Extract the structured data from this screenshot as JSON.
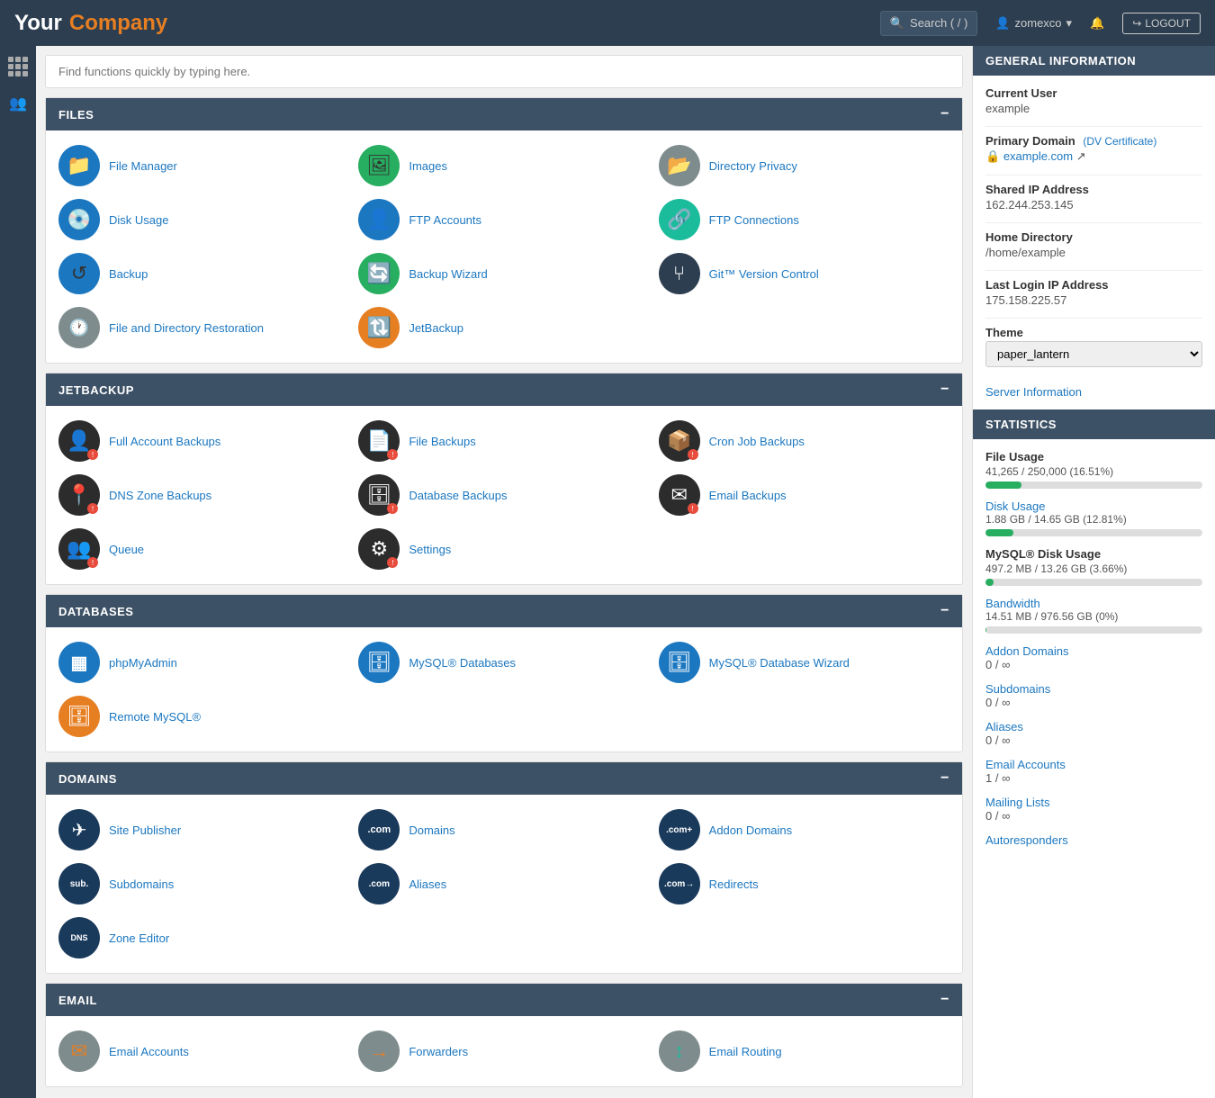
{
  "topNav": {
    "logoYour": "Your",
    "logoCompany": "Company",
    "searchPlaceholder": "Search ( / )",
    "username": "zomexco",
    "logoutLabel": "LOGOUT"
  },
  "mainSearch": {
    "placeholder": "Find functions quickly by typing here."
  },
  "sections": {
    "files": {
      "title": "FILES",
      "items": [
        {
          "label": "File Manager",
          "iconBg": "bg-blue",
          "iconText": "📁"
        },
        {
          "label": "Images",
          "iconBg": "bg-green",
          "iconText": "🖼"
        },
        {
          "label": "Directory Privacy",
          "iconBg": "bg-gray",
          "iconText": "📂"
        },
        {
          "label": "Disk Usage",
          "iconBg": "bg-blue",
          "iconText": "💿"
        },
        {
          "label": "FTP Accounts",
          "iconBg": "bg-blue",
          "iconText": "👤"
        },
        {
          "label": "FTP Connections",
          "iconBg": "bg-teal",
          "iconText": "🔗"
        },
        {
          "label": "Backup",
          "iconBg": "bg-blue",
          "iconText": "↺"
        },
        {
          "label": "Backup Wizard",
          "iconBg": "bg-green",
          "iconText": "🔄"
        },
        {
          "label": "Git™ Version Control",
          "iconBg": "bg-dark",
          "iconText": "⑂"
        },
        {
          "label": "File and Directory Restoration",
          "iconBg": "bg-gray",
          "iconText": "🕐"
        },
        {
          "label": "JetBackup",
          "iconBg": "bg-orange",
          "iconText": "🔃"
        }
      ]
    },
    "jetbackup": {
      "title": "JETBACKUP",
      "items": [
        {
          "label": "Full Account Backups",
          "iconBg": "bg-dark",
          "iconText": "👤"
        },
        {
          "label": "File Backups",
          "iconBg": "bg-dark",
          "iconText": "📄"
        },
        {
          "label": "Cron Job Backups",
          "iconBg": "bg-dark",
          "iconText": "📦"
        },
        {
          "label": "DNS Zone Backups",
          "iconBg": "bg-dark",
          "iconText": "📍"
        },
        {
          "label": "Database Backups",
          "iconBg": "bg-dark",
          "iconText": "🗄"
        },
        {
          "label": "Email Backups",
          "iconBg": "bg-dark",
          "iconText": "✉"
        },
        {
          "label": "Queue",
          "iconBg": "bg-dark",
          "iconText": "👥"
        },
        {
          "label": "Settings",
          "iconBg": "bg-dark",
          "iconText": "⚙"
        }
      ]
    },
    "databases": {
      "title": "DATABASES",
      "items": [
        {
          "label": "phpMyAdmin",
          "iconBg": "bg-blue",
          "iconText": "▦"
        },
        {
          "label": "MySQL® Databases",
          "iconBg": "bg-blue",
          "iconText": "🗄"
        },
        {
          "label": "MySQL® Database Wizard",
          "iconBg": "bg-blue",
          "iconText": "🗄"
        },
        {
          "label": "Remote MySQL®",
          "iconBg": "bg-orange",
          "iconText": "🗄"
        }
      ]
    },
    "domains": {
      "title": "DOMAINS",
      "items": [
        {
          "label": "Site Publisher",
          "iconBg": "bg-navy",
          "iconText": "✈"
        },
        {
          "label": "Domains",
          "iconBg": "bg-navy",
          "iconText": ".com"
        },
        {
          "label": "Addon Domains",
          "iconBg": "bg-navy",
          "iconText": ".com+"
        },
        {
          "label": "Subdomains",
          "iconBg": "bg-navy",
          "iconText": "sub."
        },
        {
          "label": "Aliases",
          "iconBg": "bg-navy",
          "iconText": ".com"
        },
        {
          "label": "Redirects",
          "iconBg": "bg-navy",
          "iconText": ".com→"
        },
        {
          "label": "Zone Editor",
          "iconBg": "bg-navy",
          "iconText": "DNS"
        }
      ]
    },
    "email": {
      "title": "EMAIL",
      "items": [
        {
          "label": "Email Accounts",
          "iconBg": "bg-gray",
          "iconText": "✉"
        },
        {
          "label": "Forwarders",
          "iconBg": "bg-orange",
          "iconText": "→"
        },
        {
          "label": "Email Routing",
          "iconBg": "bg-teal",
          "iconText": "↕"
        }
      ]
    }
  },
  "generalInfo": {
    "title": "GENERAL INFORMATION",
    "currentUserLabel": "Current User",
    "currentUserValue": "example",
    "primaryDomainLabel": "Primary Domain",
    "dvCertLabel": "DV Certificate",
    "domainLink": "example.com",
    "sharedIPLabel": "Shared IP Address",
    "sharedIPValue": "162.244.253.145",
    "homeDirLabel": "Home Directory",
    "homeDirValue": "/home/example",
    "lastLoginLabel": "Last Login IP Address",
    "lastLoginValue": "175.158.225.57",
    "themeLabel": "Theme",
    "themeValue": "paper_lantern",
    "serverInfoLink": "Server Information"
  },
  "statistics": {
    "title": "STATISTICS",
    "fileUsage": {
      "label": "File Usage",
      "value": "41,265 / 250,000  (16.51%)",
      "percent": 16.51,
      "color": "#27ae60"
    },
    "diskUsage": {
      "label": "Disk Usage",
      "link": "Disk Usage",
      "value": "1.88 GB / 14.65 GB  (12.81%)",
      "percent": 12.81,
      "color": "#27ae60"
    },
    "mysqlDisk": {
      "label": "MySQL® Disk Usage",
      "value": "497.2 MB / 13.26 GB  (3.66%)",
      "percent": 3.66,
      "color": "#27ae60"
    },
    "bandwidth": {
      "label": "Bandwidth",
      "link": "Bandwidth",
      "value": "14.51 MB / 976.56 GB  (0%)",
      "percent": 0.5,
      "color": "#27ae60"
    },
    "addonDomains": {
      "label": "Addon Domains",
      "link": "Addon Domains",
      "value": "0 / ∞"
    },
    "subdomains": {
      "label": "Subdomains",
      "link": "Subdomains",
      "value": "0 / ∞"
    },
    "aliases": {
      "label": "Aliases",
      "link": "Aliases",
      "value": "0 / ∞"
    },
    "emailAccounts": {
      "label": "Email Accounts",
      "link": "Email Accounts",
      "value": "1 / ∞"
    },
    "mailingLists": {
      "label": "Mailing Lists",
      "link": "Mailing Lists",
      "value": "0 / ∞"
    },
    "autoresponders": {
      "label": "Autoresponders",
      "link": "Autoresponders"
    }
  }
}
